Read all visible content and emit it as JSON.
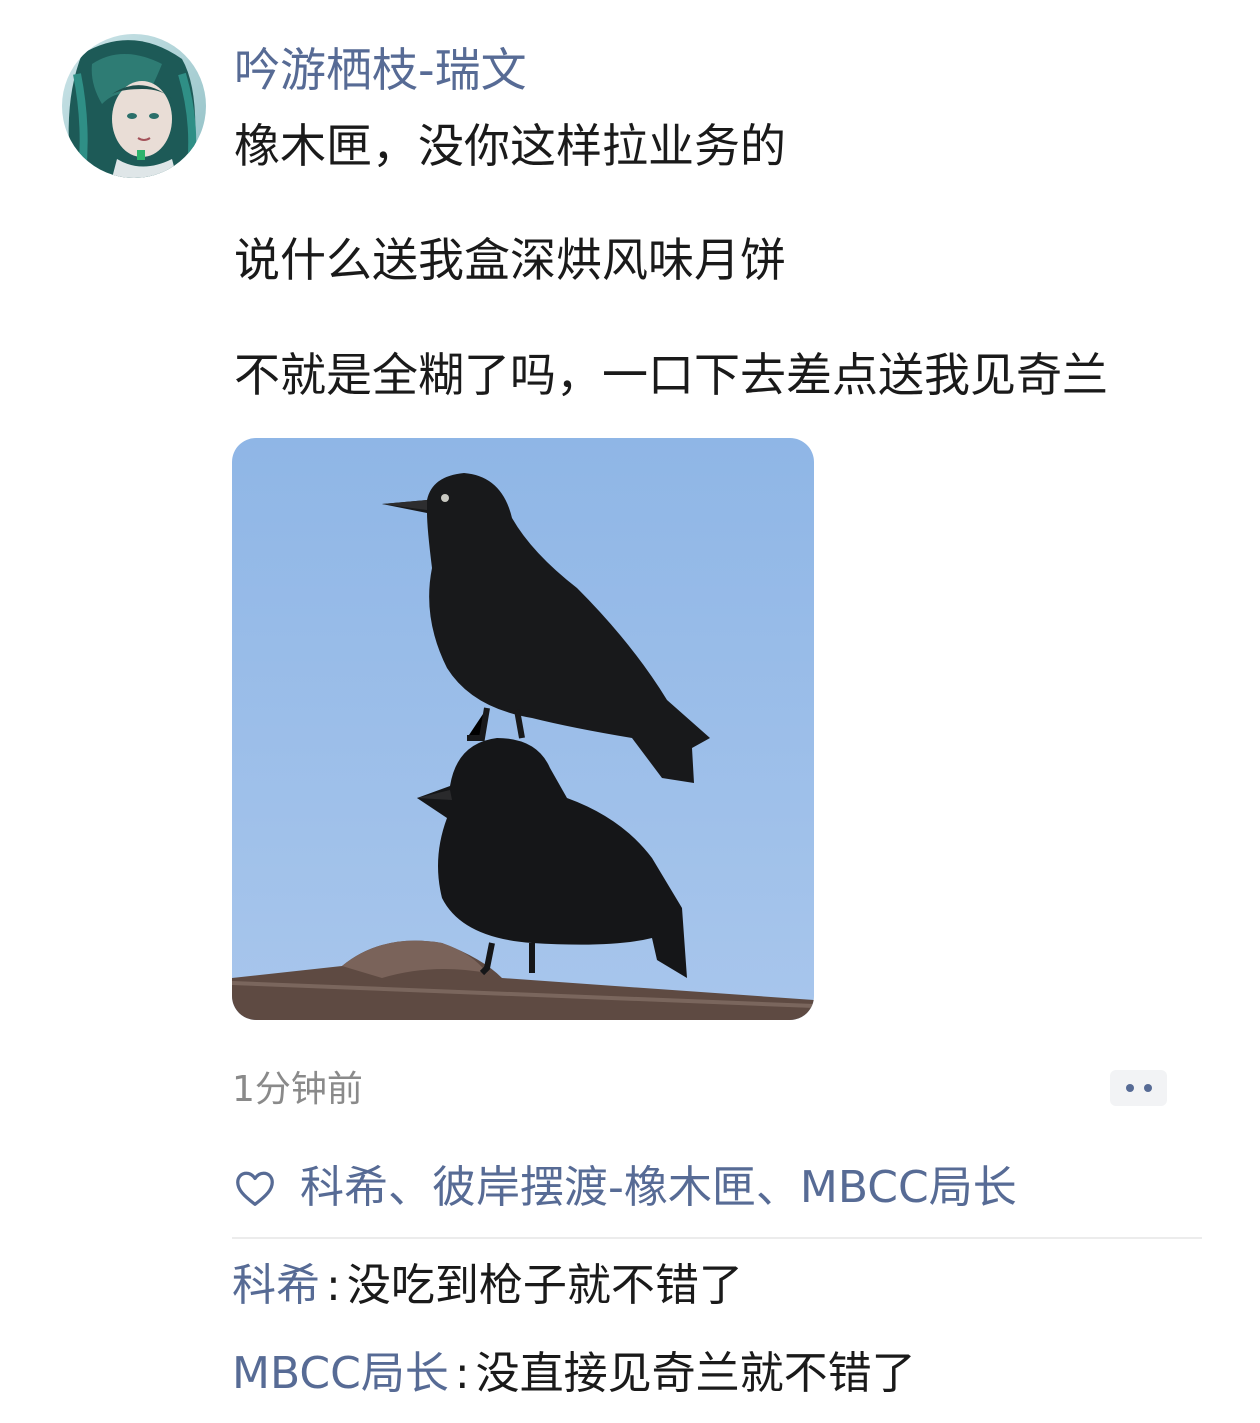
{
  "post": {
    "author": "吟游栖枝-瑞文",
    "lines": [
      "橡木匣，没你这样拉业务的",
      "说什么送我盒深烘风味月饼",
      "不就是全糊了吗，一口下去差点送我见奇兰"
    ],
    "timestamp": "1分钟前"
  },
  "likes": {
    "icon": "heart-outline-icon",
    "names": "科希、彼岸摆渡-橡木匣、MBCC局长"
  },
  "comments": [
    {
      "author": "科希",
      "separator": ":",
      "text": "没吃到枪子就不错了"
    },
    {
      "author": "MBCC局长",
      "separator": ":",
      "text": "没直接见奇兰就不错了"
    }
  ],
  "colors": {
    "link": "#576b95",
    "text": "#1a1a1a",
    "muted": "#8a8a8a",
    "sky": "#8fb4e4"
  }
}
